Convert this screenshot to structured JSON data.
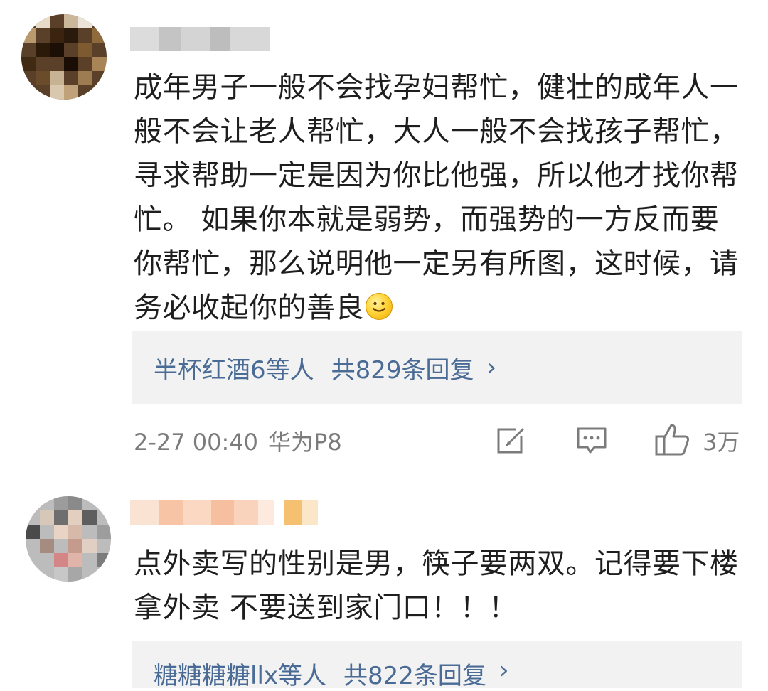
{
  "comments": [
    {
      "text": "成年男子一般不会找孕妇帮忙，健壮的成年人一般不会让老人帮忙，大人一般不会找孩子帮忙，寻求帮助一定是因为你比他强，所以他才找你帮忙。 如果你本就是弱势，而强势的一方反而要你帮忙，那么说明他一定另有所图，这时候，请务必收起你的善良",
      "emoji": "smiley-emoji",
      "replies": {
        "names": "半杯红酒6等人",
        "count": "共829条回复",
        "chevron": "›"
      },
      "time": "2-27 00:40",
      "device": "华为P8",
      "likes": "3万"
    },
    {
      "text": "点外卖写的性别是男，筷子要两双。记得要下楼拿外卖 不要送到家门口！！！",
      "replies": {
        "names": "糖糖糖糖llx等人",
        "count": "共822条回复",
        "chevron": "›"
      }
    }
  ],
  "icons": {
    "forward": "share-edit-icon",
    "comment": "comment-icon",
    "like": "thumb-up-icon"
  },
  "colors": {
    "link": "#4a6b95",
    "meta": "#7b7b7b",
    "reply_bg": "#f2f2f2"
  }
}
